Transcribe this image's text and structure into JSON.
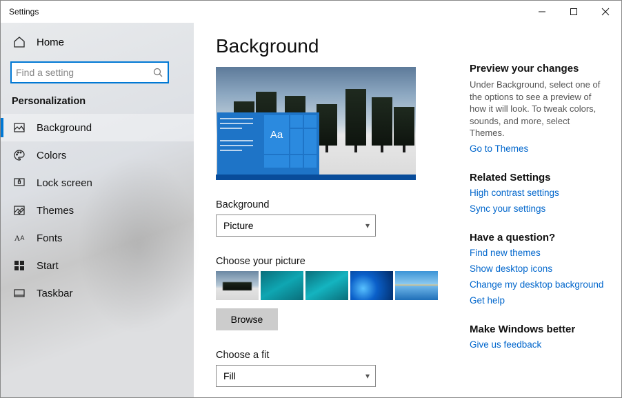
{
  "window": {
    "title": "Settings"
  },
  "sidebar": {
    "home": "Home",
    "search_placeholder": "Find a setting",
    "section": "Personalization",
    "items": [
      {
        "label": "Background",
        "active": true
      },
      {
        "label": "Colors"
      },
      {
        "label": "Lock screen"
      },
      {
        "label": "Themes"
      },
      {
        "label": "Fonts"
      },
      {
        "label": "Start"
      },
      {
        "label": "Taskbar"
      }
    ]
  },
  "page": {
    "title": "Background",
    "preview_sample_text": "Aa",
    "background_label": "Background",
    "background_value": "Picture",
    "choose_picture_label": "Choose your picture",
    "browse": "Browse",
    "choose_fit_label": "Choose a fit",
    "fit_value": "Fill"
  },
  "right": {
    "preview_head": "Preview your changes",
    "preview_text": "Under Background, select one of the options to see a preview of how it will look. To tweak colors, sounds, and more, select Themes.",
    "themes_link": "Go to Themes",
    "related_head": "Related Settings",
    "high_contrast": "High contrast settings",
    "sync": "Sync your settings",
    "question_head": "Have a question?",
    "find_themes": "Find new themes",
    "show_icons": "Show desktop icons",
    "change_bg": "Change my desktop background",
    "get_help": "Get help",
    "better_head": "Make Windows better",
    "feedback": "Give us feedback"
  }
}
